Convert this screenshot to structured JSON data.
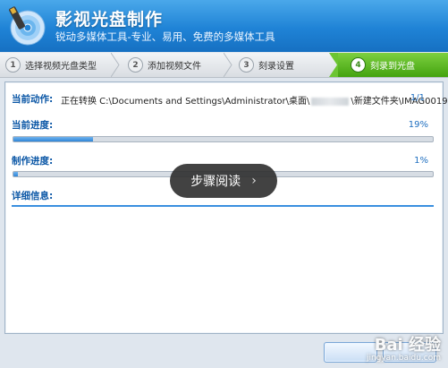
{
  "app": {
    "title": "影视光盘制作",
    "subtitle": "锐动多媒体工具-专业、易用、免费的多媒体工具"
  },
  "steps": [
    {
      "num": "1",
      "label": "选择视频光盘类型"
    },
    {
      "num": "2",
      "label": "添加视频文件"
    },
    {
      "num": "3",
      "label": "刻录设置"
    },
    {
      "num": "4",
      "label": "刻录到光盘"
    }
  ],
  "progress": {
    "current_action_label": "当前动作:",
    "current_action_text_a": "正在转换 C:\\Documents and Settings\\Administrator\\桌面\\",
    "current_action_text_b": "\\新建文件夹\\IMAG0019.",
    "current_action_count": "1/1",
    "current_progress_label": "当前进度:",
    "current_progress_pct": "19%",
    "current_progress_value": 0.19,
    "make_progress_label": "制作进度:",
    "make_progress_pct": "1%",
    "make_progress_value": 0.01,
    "details_label": "详细信息:"
  },
  "overlay": {
    "label": "步骤阅读",
    "chevron": "›"
  },
  "watermark": {
    "brand": "Bai 经验",
    "url": "jingyan.baidu.com"
  },
  "colors": {
    "title_blue": "#1f83d6",
    "active_step_green": "#43a30f",
    "progress_blue": "#2f86d8",
    "label_blue": "#0b57a6"
  }
}
